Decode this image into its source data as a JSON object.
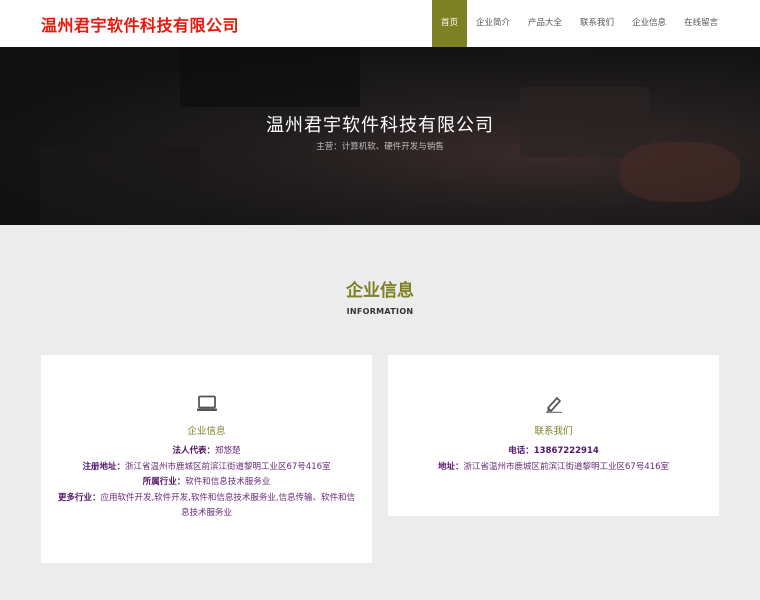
{
  "header": {
    "logo_text": "温州君宇软件科技有限公司",
    "nav": [
      {
        "label": "首页",
        "active": true
      },
      {
        "label": "企业简介",
        "active": false
      },
      {
        "label": "产品大全",
        "active": false
      },
      {
        "label": "联系我们",
        "active": false
      },
      {
        "label": "企业信息",
        "active": false
      },
      {
        "label": "在线留言",
        "active": false
      }
    ]
  },
  "hero": {
    "title": "温州君宇软件科技有限公司",
    "subtitle": "主营：计算机软、硬件开发与销售"
  },
  "section": {
    "title": "企业信息",
    "subtitle": "INFORMATION"
  },
  "company_card": {
    "icon": "laptop-icon",
    "heading": "企业信息",
    "legal_rep_label": "法人代表：",
    "legal_rep_value": "郑悠楚",
    "address_label": "注册地址：",
    "address_value": "浙江省温州市鹿城区前滨江街道黎明工业区67号416室",
    "industry_label": "所属行业：",
    "industry_value": "软件和信息技术服务业",
    "more_label": "更多行业：",
    "more_value": "应用软件开发,软件开发,软件和信息技术服务业,信息传输、软件和信息技术服务业"
  },
  "contact_card": {
    "icon": "pencil-icon",
    "heading": "联系我们",
    "phone_label": "电话：",
    "phone_value": "13867222914",
    "address_label": "地址：",
    "address_value": "浙江省温州市鹿城区前滨江街道黎明工业区67号416室"
  },
  "colors": {
    "accent": "#7e8024",
    "logo": "#e8180c",
    "info_text": "#6a2a7d"
  }
}
